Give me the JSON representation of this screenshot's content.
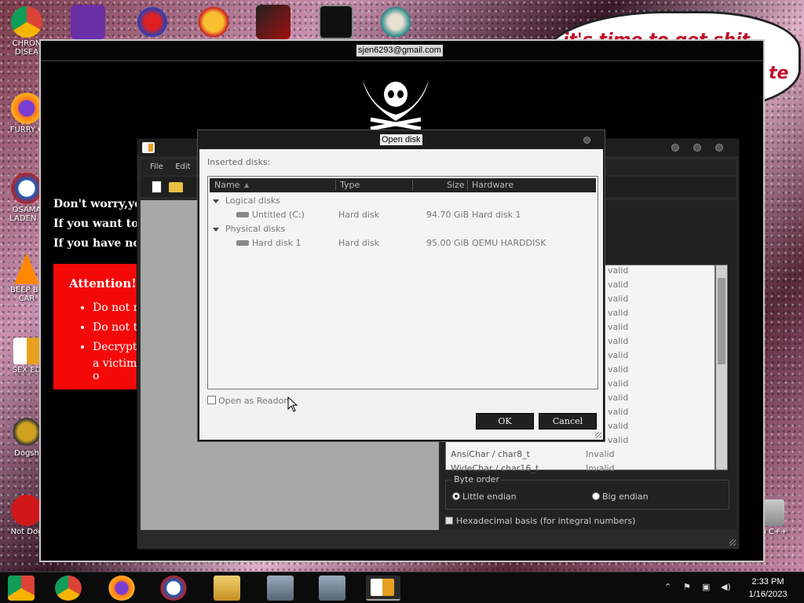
{
  "desktop": {
    "icons": [
      {
        "label": "CHRON\nDISEA",
        "icon": "chrome-icon"
      },
      {
        "label": "FURRY C",
        "icon": "firefox-icon"
      },
      {
        "label": "OSAMA\nLADEN E",
        "icon": "obama-icon"
      },
      {
        "label": "BEEP BE\nCAR",
        "icon": "vlc-icon"
      },
      {
        "label": "SEX ED",
        "icon": "hxd-icon"
      },
      {
        "label": "Dogsh",
        "icon": "dogshell-icon"
      },
      {
        "label": "Not Dog",
        "icon": "devcpp-icon"
      }
    ],
    "right_labels": {
      "cpp": "n C++"
    },
    "bubble_text": "it's time to get shit",
    "bubble_text2": "te"
  },
  "ransom": {
    "email": "sjen6293@gmail.com",
    "line1": "Don't worry,yo",
    "line2": "If you want to",
    "line3": "If you have not",
    "attention_title": "Attention!",
    "bullets": [
      "Do not re",
      "Do not tr",
      "Decryption"
    ],
    "bullet3_cont": "a victim o"
  },
  "hxd": {
    "menu": [
      "File",
      "Edit",
      "S"
    ],
    "panel": {
      "rows": [
        {
          "label": "",
          "value": "valid"
        },
        {
          "label": "",
          "value": "valid"
        },
        {
          "label": "",
          "value": "valid"
        },
        {
          "label": "",
          "value": "valid"
        },
        {
          "label": "",
          "value": "valid"
        },
        {
          "label": "",
          "value": "valid"
        },
        {
          "label": "",
          "value": "valid"
        },
        {
          "label": "",
          "value": "valid"
        },
        {
          "label": "",
          "value": "valid"
        },
        {
          "label": "",
          "value": "valid"
        },
        {
          "label": "",
          "value": "valid"
        },
        {
          "label": "",
          "value": "valid"
        },
        {
          "label": "",
          "value": "valid"
        }
      ],
      "ansichar": {
        "label": "AnsiChar / char8_t",
        "value": "Invalid"
      },
      "widechar": {
        "label": "WideChar / char16_t",
        "value": "Invalid"
      },
      "byte_order_label": "Byte order",
      "little_endian": "Little endian",
      "big_endian": "Big endian",
      "hex_basis": "Hexadecimal basis (for integral numbers)"
    }
  },
  "dialog": {
    "title": "Open disk",
    "inserted_label": "Inserted disks:",
    "columns": [
      "Name",
      "Type",
      "Size",
      "Hardware"
    ],
    "groups": [
      {
        "name": "Logical disks",
        "items": [
          {
            "name": "Untitled (C:)",
            "type": "Hard disk",
            "size": "94.70 GiB",
            "hardware": "Hard disk 1"
          }
        ]
      },
      {
        "name": "Physical disks",
        "items": [
          {
            "name": "Hard disk 1",
            "type": "Hard disk",
            "size": "95.00 GiB",
            "hardware": "QEMU HARDDISK"
          }
        ]
      }
    ],
    "open_readonly": "Open as Readon",
    "ok": "OK",
    "cancel": "Cancel"
  },
  "taskbar": {
    "time": "2:33 PM",
    "date": "1/16/2023",
    "apps": [
      "chrome-alt-icon",
      "chrome-icon",
      "firefox-icon",
      "obama-icon",
      "file-explorer-icon",
      "installer-icon",
      "installer-icon",
      "hxd-icon"
    ]
  }
}
